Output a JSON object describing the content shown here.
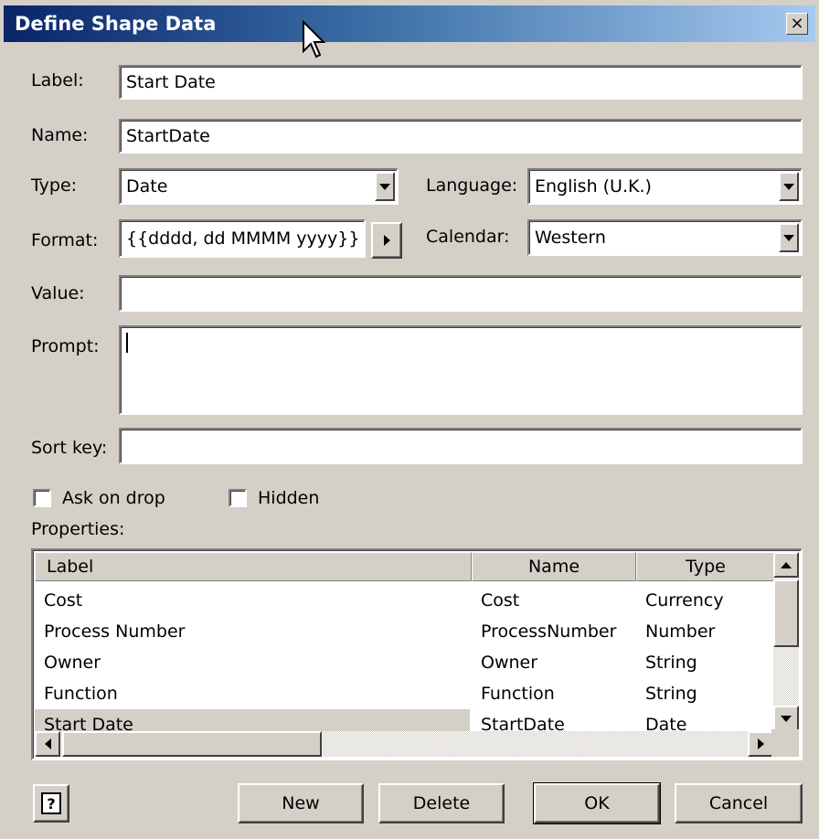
{
  "window": {
    "title": "Define Shape Data",
    "close_glyph": "×"
  },
  "fields": {
    "label": {
      "label": "Label:",
      "value": "Start Date"
    },
    "name": {
      "label": "Name:",
      "value": "StartDate"
    },
    "type": {
      "label": "Type:",
      "value": "Date"
    },
    "language": {
      "label": "Language:",
      "value": "English (U.K.)"
    },
    "format": {
      "label": "Format:",
      "value": "{{dddd, dd MMMM yyyy}}"
    },
    "calendar": {
      "label": "Calendar:",
      "value": "Western"
    },
    "value": {
      "label": "Value:",
      "value": ""
    },
    "prompt": {
      "label": "Prompt:",
      "value": ""
    },
    "sort_key": {
      "label": "Sort key:",
      "value": ""
    }
  },
  "checkboxes": {
    "ask_on_drop": {
      "label": "Ask on drop",
      "checked": false
    },
    "hidden": {
      "label": "Hidden",
      "checked": false
    }
  },
  "properties": {
    "heading": "Properties:",
    "columns": [
      "Label",
      "Name",
      "Type"
    ],
    "rows": [
      {
        "label": "Cost",
        "name": "Cost",
        "type": "Currency"
      },
      {
        "label": "Process Number",
        "name": "ProcessNumber",
        "type": "Number"
      },
      {
        "label": "Owner",
        "name": "Owner",
        "type": "String"
      },
      {
        "label": "Function",
        "name": "Function",
        "type": "String"
      },
      {
        "label": "Start Date",
        "name": "StartDate",
        "type": "Date"
      }
    ],
    "selected_index": 4
  },
  "buttons": {
    "help_glyph": "?",
    "new": "New",
    "delete": "Delete",
    "ok": "OK",
    "cancel": "Cancel"
  },
  "colors": {
    "title_start": "#0a246a",
    "title_end": "#a6caf0",
    "face": "#d4d0c8"
  }
}
